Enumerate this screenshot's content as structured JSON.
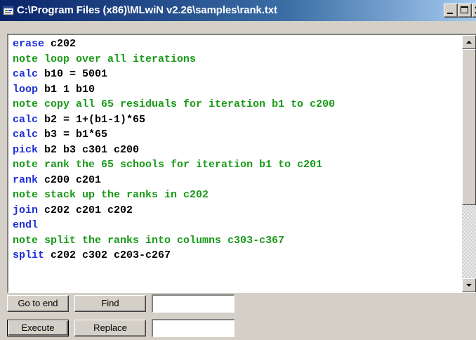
{
  "window": {
    "title": "C:\\Program Files (x86)\\MLwiN v2.26\\samples\\rank.txt"
  },
  "colors": {
    "command": "#1e2fd6",
    "note": "#1a9a1a",
    "titlebar": "#0a246a"
  },
  "editor": {
    "lines": [
      {
        "cmd": "erase",
        "args": " c202"
      },
      {
        "cmd": "note",
        "args": " loop over all iterations"
      },
      {
        "cmd": "calc",
        "args": " b10 = 5001"
      },
      {
        "cmd": "loop",
        "args": " b1 1 b10"
      },
      {
        "cmd": "note",
        "args": " copy all 65 residuals for iteration b1 to c200"
      },
      {
        "cmd": "calc",
        "args": " b2 = 1+(b1-1)*65"
      },
      {
        "cmd": "calc",
        "args": " b3 = b1*65"
      },
      {
        "cmd": "pick",
        "args": " b2 b3 c301 c200"
      },
      {
        "cmd": "note",
        "args": " rank the 65 schools for iteration b1 to c201"
      },
      {
        "cmd": "rank",
        "args": " c200 c201"
      },
      {
        "cmd": "note",
        "args": " stack up the ranks in c202"
      },
      {
        "cmd": "join",
        "args": " c202 c201 c202"
      },
      {
        "cmd": "endl",
        "args": ""
      },
      {
        "cmd": "note",
        "args": " split the ranks into columns c303-c367"
      },
      {
        "cmd": "split",
        "args": " c202 c302 c203-c267"
      }
    ]
  },
  "toolbar": {
    "goto_end_label": "Go to end",
    "find_label": "Find",
    "find_value": "",
    "execute_label": "Execute",
    "replace_label": "Replace",
    "replace_value": ""
  }
}
